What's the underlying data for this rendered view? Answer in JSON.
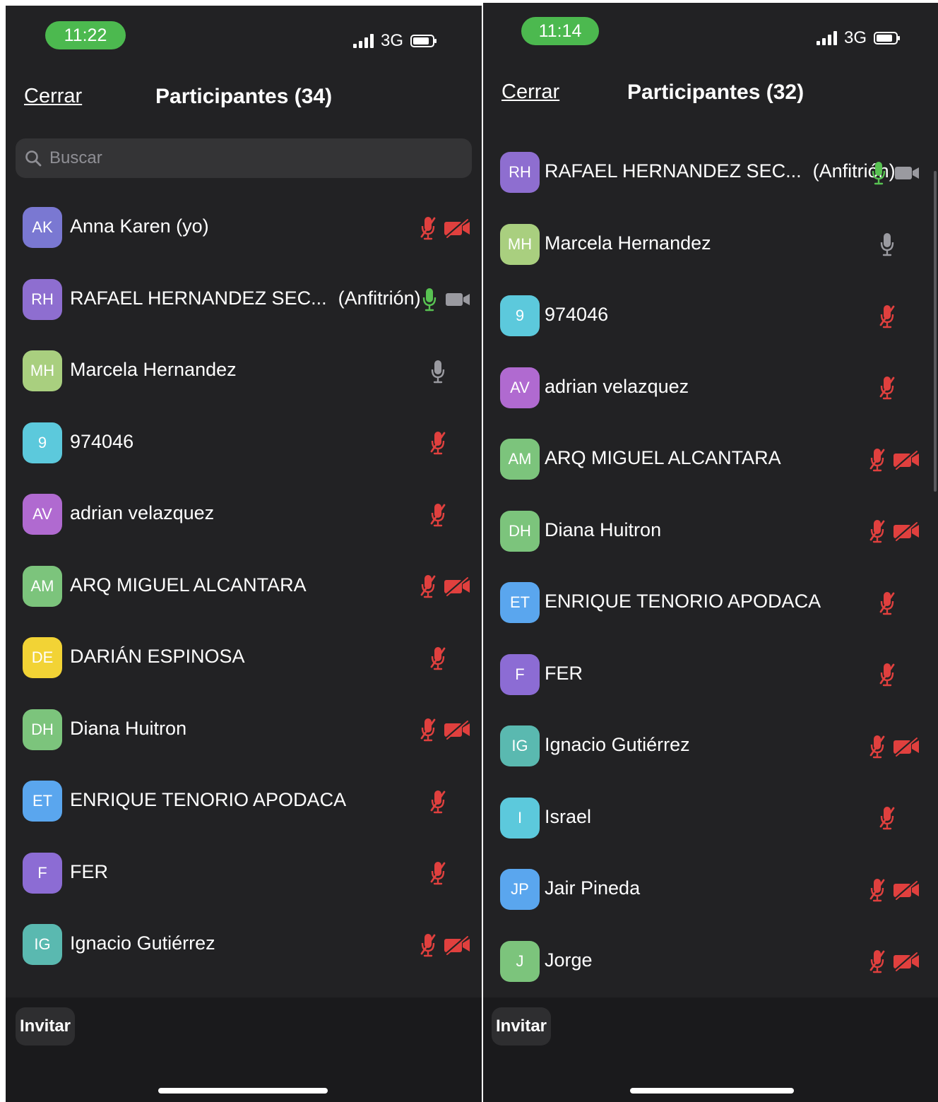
{
  "colors": {
    "background": "#222224",
    "time_pill": "#4cb94f",
    "muted_red": "#e0403e",
    "mic_active": "#58c252",
    "icon_gray": "#9a9aa0"
  },
  "left": {
    "status": {
      "time": "11:22",
      "network": "3G"
    },
    "header": {
      "close_label": "Cerrar",
      "title": "Participantes (34)"
    },
    "search": {
      "placeholder": "Buscar"
    },
    "participants": [
      {
        "initials": "AK",
        "name": "Anna Karen (yo)",
        "role": "",
        "color": "#7a78d2",
        "mic": "muted",
        "video": "off"
      },
      {
        "initials": "RH",
        "name": "RAFAEL HERNANDEZ SEC...",
        "role": "(Anfitrión)",
        "color": "#8e6ed0",
        "mic": "active",
        "video": "on"
      },
      {
        "initials": "MH",
        "name": "Marcela Hernandez",
        "role": "",
        "color": "#a9cf7f",
        "mic": "idle",
        "video": "none"
      },
      {
        "initials": "9",
        "name": "974046",
        "role": "",
        "color": "#5cc9dc",
        "mic": "muted",
        "video": "none"
      },
      {
        "initials": "AV",
        "name": "adrian velazquez",
        "role": "",
        "color": "#b06ad0",
        "mic": "muted",
        "video": "none"
      },
      {
        "initials": "AM",
        "name": "ARQ MIGUEL ALCANTARA",
        "role": "",
        "color": "#7cc47c",
        "mic": "muted",
        "video": "off"
      },
      {
        "initials": "DE",
        "name": "DARIÁN ESPINOSA",
        "role": "",
        "color": "#f2d335",
        "mic": "muted",
        "video": "none"
      },
      {
        "initials": "DH",
        "name": "Diana Huitron",
        "role": "",
        "color": "#7cc47c",
        "mic": "muted",
        "video": "off"
      },
      {
        "initials": "ET",
        "name": "ENRIQUE TENORIO APODACA",
        "role": "",
        "color": "#5aa6ee",
        "mic": "muted",
        "video": "none"
      },
      {
        "initials": "F",
        "name": "FER",
        "role": "",
        "color": "#8c6cd4",
        "mic": "muted",
        "video": "none"
      },
      {
        "initials": "IG",
        "name": "Ignacio Gutiérrez",
        "role": "",
        "color": "#5ab9b0",
        "mic": "muted",
        "video": "off"
      }
    ],
    "invite_label": "Invitar"
  },
  "right": {
    "status": {
      "time": "11:14",
      "network": "3G"
    },
    "header": {
      "close_label": "Cerrar",
      "title": "Participantes (32)"
    },
    "participants": [
      {
        "initials": "RH",
        "name": "RAFAEL HERNANDEZ SEC...",
        "role": "(Anfitrión)",
        "color": "#8e6ed0",
        "mic": "active",
        "video": "on"
      },
      {
        "initials": "MH",
        "name": "Marcela Hernandez",
        "role": "",
        "color": "#a9cf7f",
        "mic": "idle",
        "video": "none"
      },
      {
        "initials": "9",
        "name": "974046",
        "role": "",
        "color": "#5cc9dc",
        "mic": "muted",
        "video": "none"
      },
      {
        "initials": "AV",
        "name": "adrian velazquez",
        "role": "",
        "color": "#b06ad0",
        "mic": "muted",
        "video": "none"
      },
      {
        "initials": "AM",
        "name": "ARQ MIGUEL ALCANTARA",
        "role": "",
        "color": "#7cc47c",
        "mic": "muted",
        "video": "off"
      },
      {
        "initials": "DH",
        "name": "Diana Huitron",
        "role": "",
        "color": "#7cc47c",
        "mic": "muted",
        "video": "off"
      },
      {
        "initials": "ET",
        "name": "ENRIQUE TENORIO APODACA",
        "role": "",
        "color": "#5aa6ee",
        "mic": "muted",
        "video": "none"
      },
      {
        "initials": "F",
        "name": "FER",
        "role": "",
        "color": "#8c6cd4",
        "mic": "muted",
        "video": "none"
      },
      {
        "initials": "IG",
        "name": "Ignacio Gutiérrez",
        "role": "",
        "color": "#5ab9b0",
        "mic": "muted",
        "video": "off"
      },
      {
        "initials": "I",
        "name": "Israel",
        "role": "",
        "color": "#5cc9dc",
        "mic": "muted",
        "video": "none"
      },
      {
        "initials": "JP",
        "name": "Jair Pineda",
        "role": "",
        "color": "#5aa6ee",
        "mic": "muted",
        "video": "off"
      },
      {
        "initials": "J",
        "name": "Jorge",
        "role": "",
        "color": "#7cc47c",
        "mic": "muted",
        "video": "off"
      }
    ],
    "invite_label": "Invitar"
  }
}
